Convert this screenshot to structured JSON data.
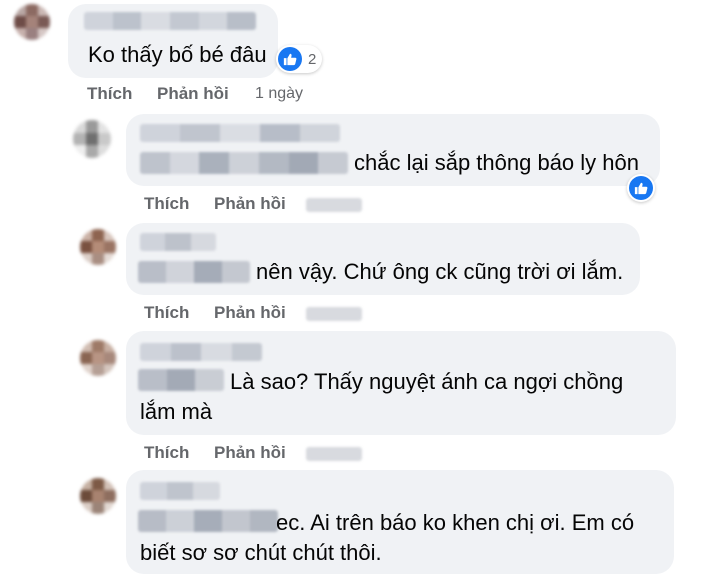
{
  "comments": [
    {
      "text_lines": [
        "Ko thấy bố bé đâu"
      ],
      "reaction": {
        "icon": "like-icon",
        "count": "2"
      },
      "actions": {
        "like": "Thích",
        "reply": "Phản hồi",
        "time": "1 ngày"
      }
    },
    {
      "text_lines": [
        "chắc lại sắp thông báo ly hôn"
      ],
      "reaction": {
        "icon": "like-icon"
      },
      "actions": {
        "like": "Thích",
        "reply": "Phản hồi"
      }
    },
    {
      "text_lines": [
        "nên vậy. Chứ ông ck cũng trời ơi lắm."
      ],
      "actions": {
        "like": "Thích",
        "reply": "Phản hồi"
      }
    },
    {
      "text_lines": [
        "Là sao? Thấy nguyệt ánh ca ngợi chồng",
        "lắm mà"
      ],
      "actions": {
        "like": "Thích",
        "reply": "Phản hồi"
      }
    },
    {
      "text_lines": [
        "ec. Ai trên báo ko khen chị ơi. Em có",
        "biết sơ sơ chút chút thôi."
      ]
    }
  ],
  "colors": {
    "bubble": "#f0f2f5",
    "action_text": "#65676b",
    "like_blue": "#1877f2",
    "comment_text": "#050505"
  }
}
